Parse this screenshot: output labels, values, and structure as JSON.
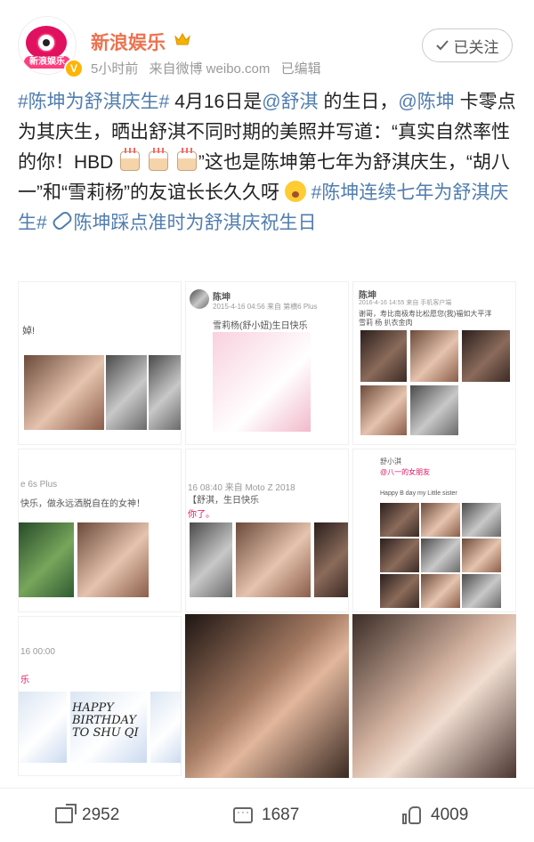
{
  "post": {
    "author": {
      "name": "新浪娱乐",
      "avatar_label": "新浪娱乐",
      "verified": true
    },
    "time": "5小时前",
    "source": "来自微博 weibo.com",
    "edited": "已编辑",
    "follow_label": "已关注",
    "text": {
      "hashtag1": "#陈坤为舒淇庆生#",
      "t1": " 4月16日是",
      "mention_shuqi": "@舒淇",
      "t2": " 的生日，",
      "mention_chenkun": "@陈坤",
      "t3": " 卡零点为其庆生，晒出舒淇不同时期的美照并写道：“真实自然率性的你！HBD ",
      "t4": "”这也是陈坤第七年为舒淇庆生，“胡八一”和“雪莉杨”的友谊长长久久呀 ",
      "hashtag2": "#陈坤连续七年为舒淇庆生#",
      "link_text": "陈坤踩点准时为舒淇庆祝生日"
    }
  },
  "images": {
    "img1": {
      "text_a": "婥!"
    },
    "img2": {
      "username": "陈坤",
      "meta": "2015-4-16 04:56 来自 第横6 Plus",
      "caption": "雪莉杨(舒小妞)生日快乐"
    },
    "img3": {
      "username": "陈坤",
      "meta": "2016-4-16 14:55 来自 手机客户端",
      "caption": "谢哥，寿比南极寿比松愿您(我)福如大平洋",
      "tags": "雪莉 杨 扒衣金肉"
    },
    "img4": {
      "meta": "e 6s Plus",
      "caption": "快乐，做永远洒脱自在的女神！"
    },
    "img5": {
      "meta": "16 08:40 来自 Moto Z 2018",
      "caption_a": "【舒淇，生日快乐",
      "caption_b": "你了。"
    },
    "img6": {
      "meta_a": "舒小淇",
      "meta_b": "@八一的女朋友",
      "caption": "Happy B day my Little sister"
    },
    "img7": {
      "meta": "16 00:00",
      "caption": "乐",
      "poster_text": "HAPPY BIRTHDAY TO SHU QI"
    }
  },
  "actions": {
    "share_count": "2952",
    "comment_count": "1687",
    "like_count": "4009"
  },
  "colors": {
    "name": "#eb7350",
    "link": "#507daf",
    "meta": "#999999"
  }
}
